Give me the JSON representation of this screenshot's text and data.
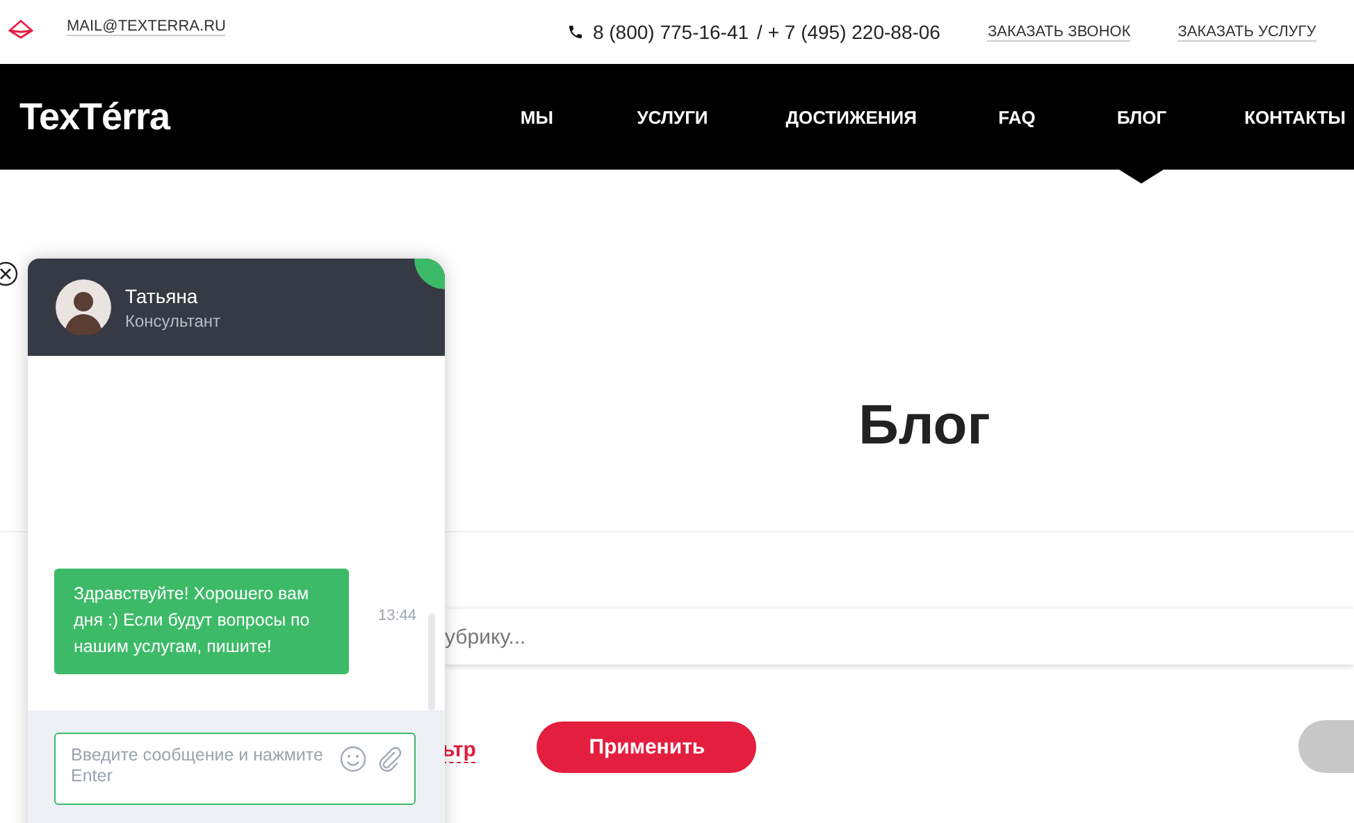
{
  "topbar": {
    "email": "MAIL@TEXTERRA.RU",
    "phone_1": "8 (800) 775-16-41",
    "phone_separator": "/ + 7 (495) 220-88-06",
    "links": [
      "ЗАКАЗАТЬ ЗВОНОК",
      "ЗАКАЗАТЬ УСЛУГУ"
    ]
  },
  "nav": {
    "logo": "TexTérra",
    "items": [
      {
        "label": "МЫ",
        "selected": false
      },
      {
        "label": "УСЛУГИ",
        "selected": false
      },
      {
        "label": "ДОСТИЖЕНИЯ",
        "selected": false
      },
      {
        "label": "FAQ",
        "selected": false
      },
      {
        "label": "БЛОГ",
        "selected": true
      },
      {
        "label": "КОНТАКТЫ",
        "selected": false
      }
    ]
  },
  "page": {
    "title": "Блог",
    "search": {
      "placeholder": "убрику..."
    },
    "filter_link": "ьтр",
    "apply_button": "Применить"
  },
  "chat": {
    "agent_name": "Татьяна",
    "agent_role": "Консультант",
    "online": true,
    "messages": [
      {
        "text": "Здравствуйте! Хорошего вам дня :) Если будут вопросы по нашим услугам, пишите!",
        "time": "13:44"
      }
    ],
    "input": {
      "placeholder": "Введите сообщение и нажмите Enter"
    }
  }
}
